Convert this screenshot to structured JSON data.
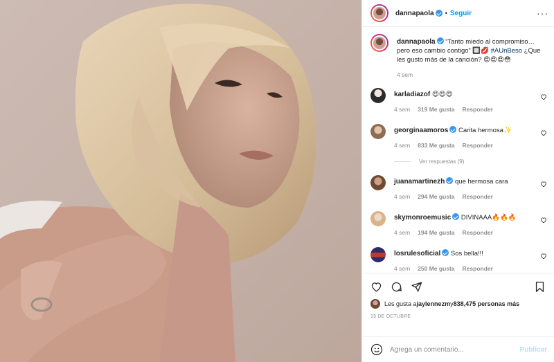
{
  "header": {
    "username": "dannapaola",
    "follow_label": "Seguir",
    "more_label": "···"
  },
  "caption": {
    "username": "dannapaola",
    "text": "“Tanto miedo al compromiso… pero eso cambio contigo” 🔲💋 ",
    "hashtag": "#AUnBeso",
    "text_after": " ¿Que les gusto más de la canción? 😍😍😍😳",
    "time": "4 sem"
  },
  "comments": [
    {
      "username": "karladiazof",
      "text": "😍😍😍",
      "time": "4 sem",
      "likes": "319 Me gusta",
      "reply": "Responder",
      "verified": false,
      "avatar_color": "#2b2b2b"
    },
    {
      "username": "georginaamoros",
      "text": "Carita hermosa✨",
      "time": "4 sem",
      "likes": "833 Me gusta",
      "reply": "Responder",
      "verified": true,
      "avatar_color": "#9a7a63",
      "replies": "Ver respuestas (9)"
    },
    {
      "username": "juanamartinezh",
      "text": "que hermosa cara",
      "time": "4 sem",
      "likes": "294 Me gusta",
      "reply": "Responder",
      "verified": true,
      "avatar_color": "#8a5a3b"
    },
    {
      "username": "skymonroemusic",
      "text": "DIVINAAA🔥🔥🔥",
      "time": "4 sem",
      "likes": "194 Me gusta",
      "reply": "Responder",
      "verified": true,
      "avatar_color": "#d9b48a"
    },
    {
      "username": "losrulesoficial",
      "text": "Sos bella!!!",
      "time": "4 sem",
      "likes": "250 Me gusta",
      "reply": "Responder",
      "verified": true,
      "avatar_color": "#c0392b"
    }
  ],
  "actions": {
    "icons": [
      "heart-icon",
      "comment-icon",
      "share-icon",
      "bookmark-icon"
    ]
  },
  "likes": {
    "prefix": "Les gusta a ",
    "user": "jaylennezm",
    "middle": " y ",
    "count": "838,475 personas más"
  },
  "date": "15 DE OCTUBRE",
  "composer": {
    "placeholder": "Agrega un comentario...",
    "post_label": "Publicar"
  },
  "colors": {
    "accent": "#0095f6",
    "verified": "#3897f0",
    "muted": "#8e8e8e"
  }
}
